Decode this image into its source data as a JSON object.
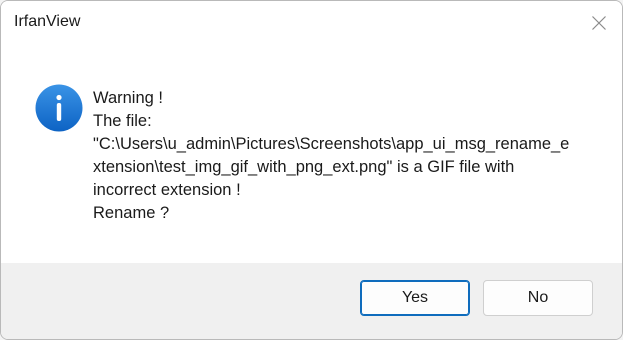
{
  "window": {
    "title": "IrfanView"
  },
  "message": {
    "lines": [
      "Warning !",
      "The file:",
      "\"C:\\Users\\u_admin\\Pictures\\Screenshots\\app_ui_msg_rename_e",
      "xtension\\test_img_gif_with_png_ext.png\" is a GIF file with",
      "incorrect extension !",
      "Rename ?"
    ]
  },
  "buttons": {
    "yes_label": "Yes",
    "no_label": "No"
  },
  "icons": {
    "dialog_icon": "info-icon",
    "close": "close-icon"
  },
  "colors": {
    "accent": "#0f6cbd",
    "info_icon": "#1b78d6",
    "footer_bg": "#f0f0f0"
  }
}
